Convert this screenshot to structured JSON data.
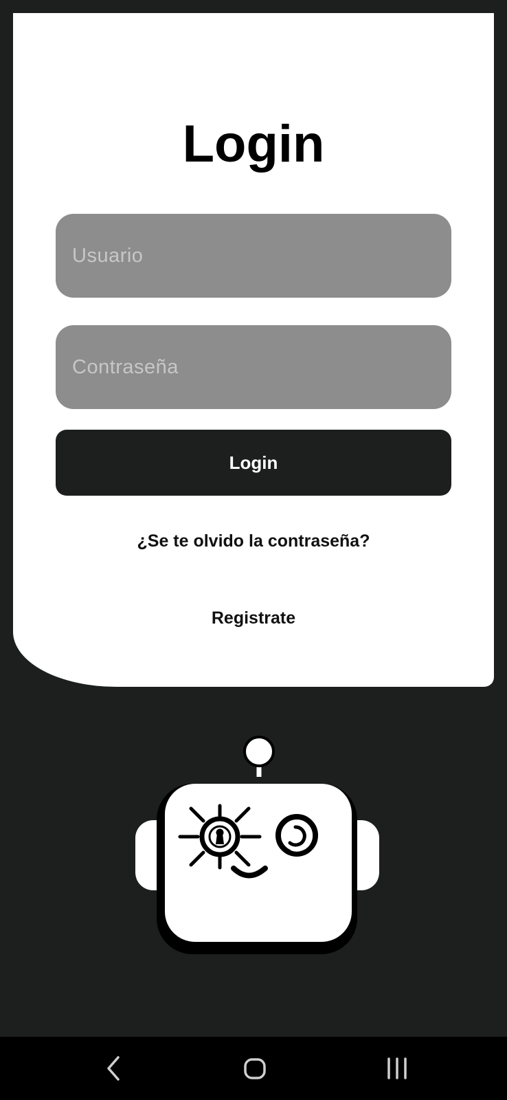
{
  "login": {
    "title": "Login",
    "username_placeholder": "Usuario",
    "password_placeholder": "Contraseña",
    "submit_label": "Login",
    "forgot_password": "¿Se te olvido la contraseña?",
    "register": "Registrate"
  },
  "colors": {
    "background_dark": "#1d1f1f",
    "card": "#ffffff",
    "input_fill": "#8d8d8d",
    "button": "#1d1f1f",
    "nav_bar": "#000000"
  },
  "icons": {
    "logo": "robot-lock-logo",
    "nav_back": "back-chevron-icon",
    "nav_home": "home-icon",
    "nav_recents": "recent-apps-icon"
  }
}
